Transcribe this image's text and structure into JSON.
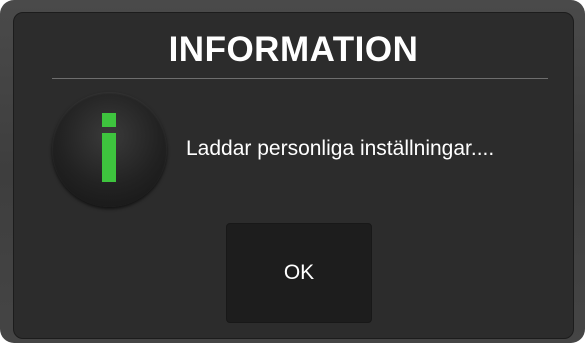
{
  "dialog": {
    "title": "INFORMATION",
    "message": "Laddar personliga inställningar....",
    "icon": "info-icon",
    "ok_label": "OK"
  },
  "colors": {
    "dialog_background": "#2c2c2c",
    "frame_background": "#444444",
    "button_background": "#1d1d1d",
    "icon_accent": "#3ec43e",
    "text": "#ffffff"
  }
}
